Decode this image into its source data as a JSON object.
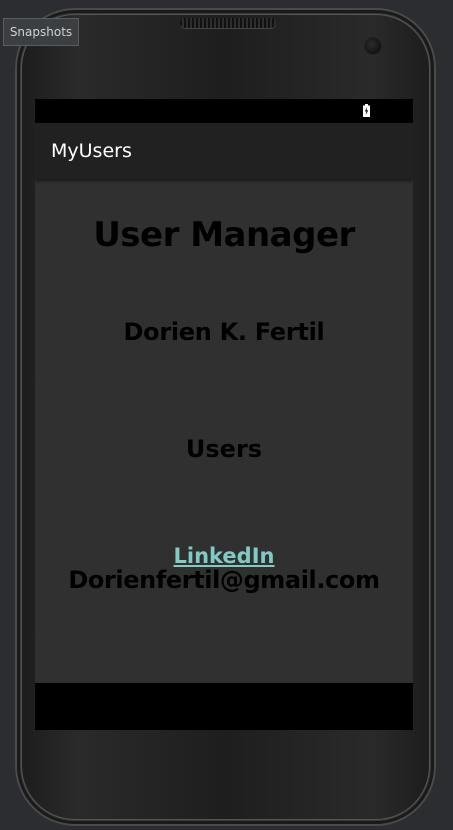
{
  "emulator": {
    "snapshots_label": "Snapshots"
  },
  "app": {
    "title": "MyUsers"
  },
  "status_bar": {
    "battery_icon": "battery-charging-icon"
  },
  "main": {
    "heading": "User Manager",
    "user_name": "Dorien K. Fertil",
    "users_label": "Users",
    "linkedin_label": "LinkedIn",
    "email": "Dorienfertil@gmail.com"
  },
  "colors": {
    "app_bar": "#212121",
    "content_background": "#303030",
    "link": "#80cbc4",
    "text": "#000000"
  }
}
